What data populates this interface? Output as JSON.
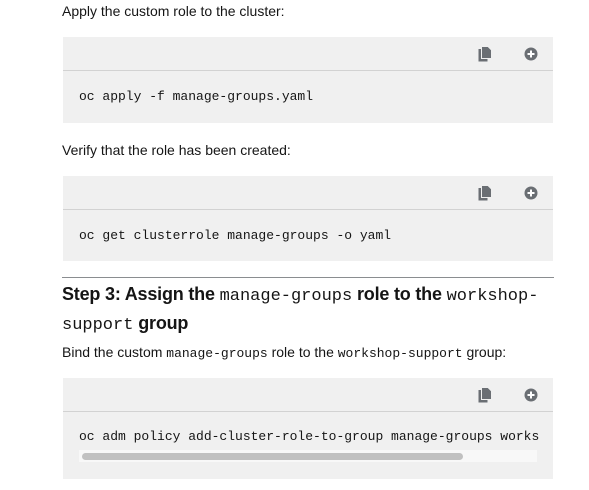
{
  "intro": {
    "apply_text": "Apply the custom role to the cluster:",
    "verify_text": "Verify that the role has been created:"
  },
  "code_blocks": [
    {
      "command": "oc apply -f manage-groups.yaml"
    },
    {
      "command": "oc get clusterrole manage-groups -o yaml"
    },
    {
      "command": "oc adm policy add-cluster-role-to-group manage-groups works"
    }
  ],
  "icons": {
    "copy": "copy-icon",
    "expand": "plus-circle-icon"
  },
  "step3": {
    "heading_prefix": "Step 3: Assign the ",
    "heading_code1": "manage-groups",
    "heading_mid": " role to the ",
    "heading_code2": "workshop-support",
    "heading_suffix": " group",
    "bind_prefix": "Bind the custom ",
    "bind_code1": "manage-groups",
    "bind_mid": " role to the ",
    "bind_code2": "workshop-support",
    "bind_suffix": " group:"
  },
  "colors": {
    "code_background": "#f0f0f0",
    "icon": "#6a6e73",
    "text": "#151515"
  }
}
